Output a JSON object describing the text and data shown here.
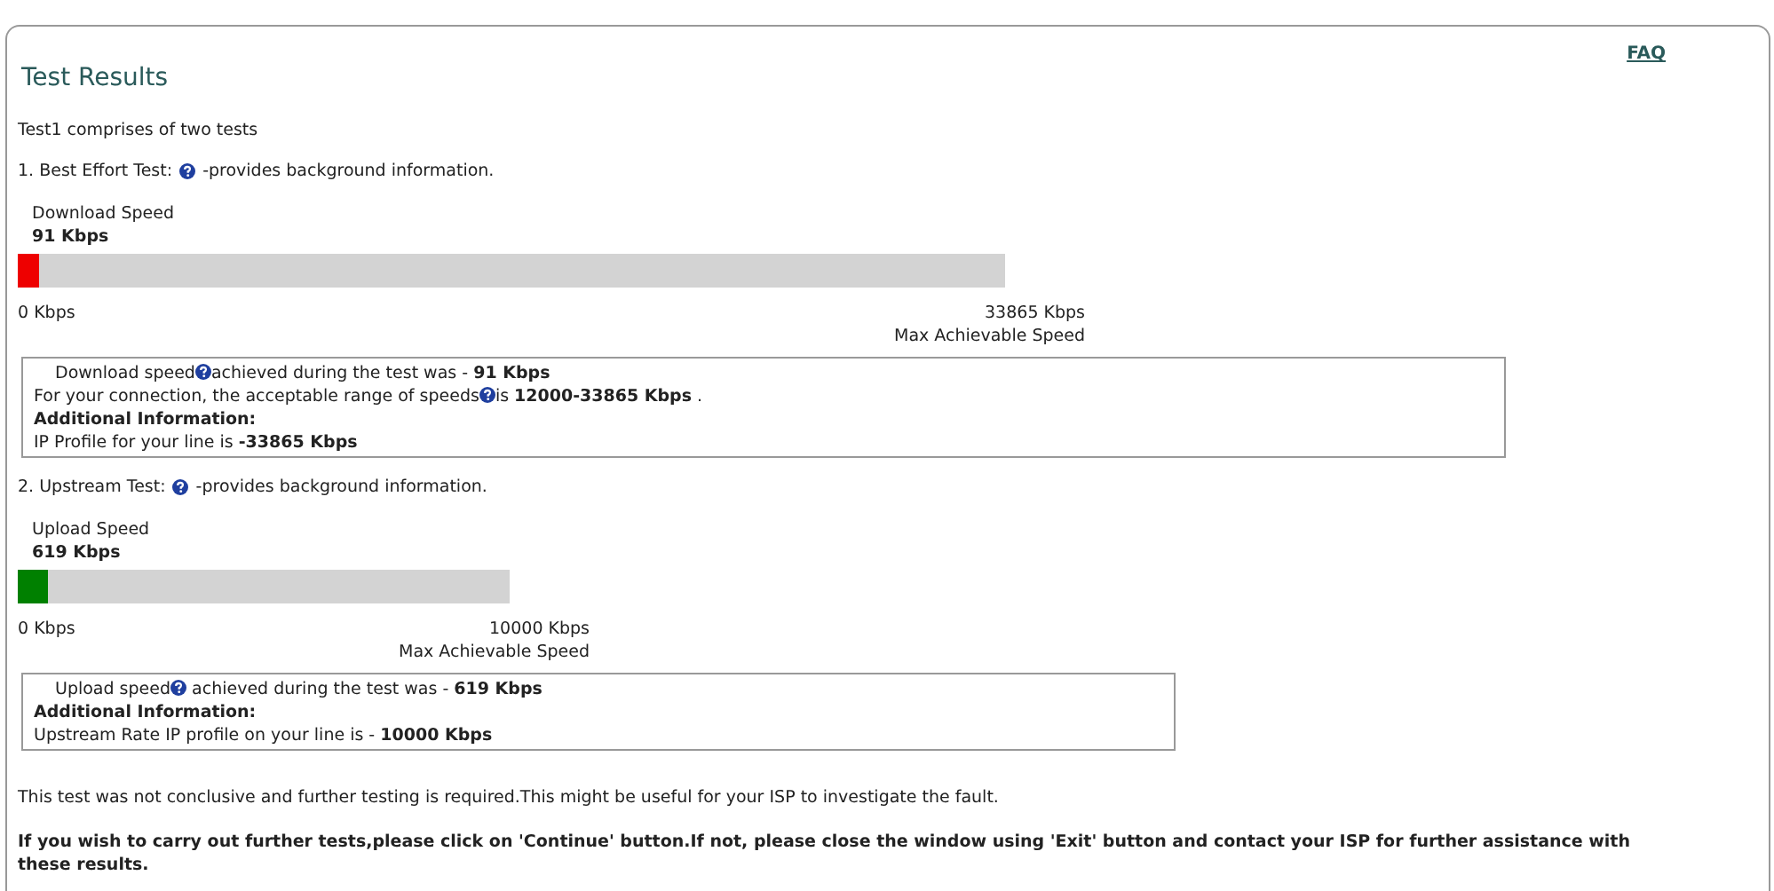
{
  "faq_link": "FAQ",
  "title": "Test Results",
  "intro": "Test1 comprises of two tests",
  "tests": [
    {
      "heading": "1. Best Effort Test:",
      "help_icon": true,
      "heading_note": "-provides background information.",
      "meter_label": "Download Speed",
      "meter_value": "91 Kbps",
      "level": 0.022,
      "color": "#ee0000",
      "min_label": "0 Kbps",
      "max_label": "33865 Kbps",
      "max_caption": "Max Achievable Speed",
      "info": [
        {
          "kind": "help",
          "before": "Download speed",
          "after": "achieved during the test was - **91 Kbps**"
        },
        {
          "kind": "help",
          "before": "For your connection, the acceptable range of speeds",
          "after": "is **12000-33865 Kbps** ."
        },
        {
          "kind": "bold",
          "text": "Additional Information:"
        },
        {
          "kind": "plain",
          "text": "IP Profile for your line is **-33865 Kbps**"
        }
      ]
    },
    {
      "heading": "2. Upstream Test:",
      "help_icon": true,
      "heading_note": "-provides background information.",
      "meter_label": "Upload Speed",
      "meter_value": "619 Kbps",
      "level": 0.06,
      "color": "#008000",
      "min_label": "0 Kbps",
      "max_label": "10000 Kbps",
      "max_caption": "Max Achievable Speed",
      "info": [
        {
          "kind": "help",
          "before": "Upload speed",
          "after": " achieved during the test was - **619 Kbps**"
        },
        {
          "kind": "bold",
          "text": "Additional Information:"
        },
        {
          "kind": "plain",
          "text": "Upstream Rate IP profile on your line is - **10000 Kbps**"
        }
      ]
    }
  ],
  "note": "This test was not conclusive and further testing is required.This might be useful for your ISP to investigate the fault.",
  "instruction": "If you wish to carry out further tests,please click on 'Continue' button.If not, please close the window using 'Exit' button and contact your ISP for further assistance with these results."
}
